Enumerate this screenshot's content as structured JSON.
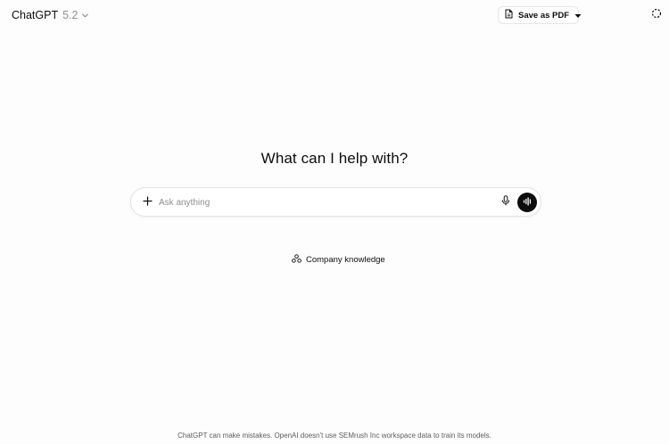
{
  "header": {
    "model_name": "ChatGPT",
    "model_version": "5.2",
    "save_pdf_label": "Save as PDF"
  },
  "main": {
    "heading": "What can I help with?",
    "composer_placeholder": "Ask anything",
    "chip_label": "Company knowledge"
  },
  "footer": {
    "disclaimer": "ChatGPT can make mistakes. OpenAI doesn't use SEMrush Inc workspace data to train its models."
  },
  "icons": {
    "model_dropdown": "chevron-down-icon",
    "save_pdf": "document-icon",
    "save_pdf_dropdown": "caret-down-icon",
    "header_right": "dashed-circle-icon",
    "attach": "plus-icon",
    "mic": "microphone-icon",
    "voice": "voice-waveform-icon",
    "chip": "connector-icon"
  },
  "colors": {
    "text_primary": "#0d0d0d",
    "text_secondary": "#8f8f8f",
    "voice_button": "#0d0d0d",
    "border": "#e3e3e3"
  }
}
